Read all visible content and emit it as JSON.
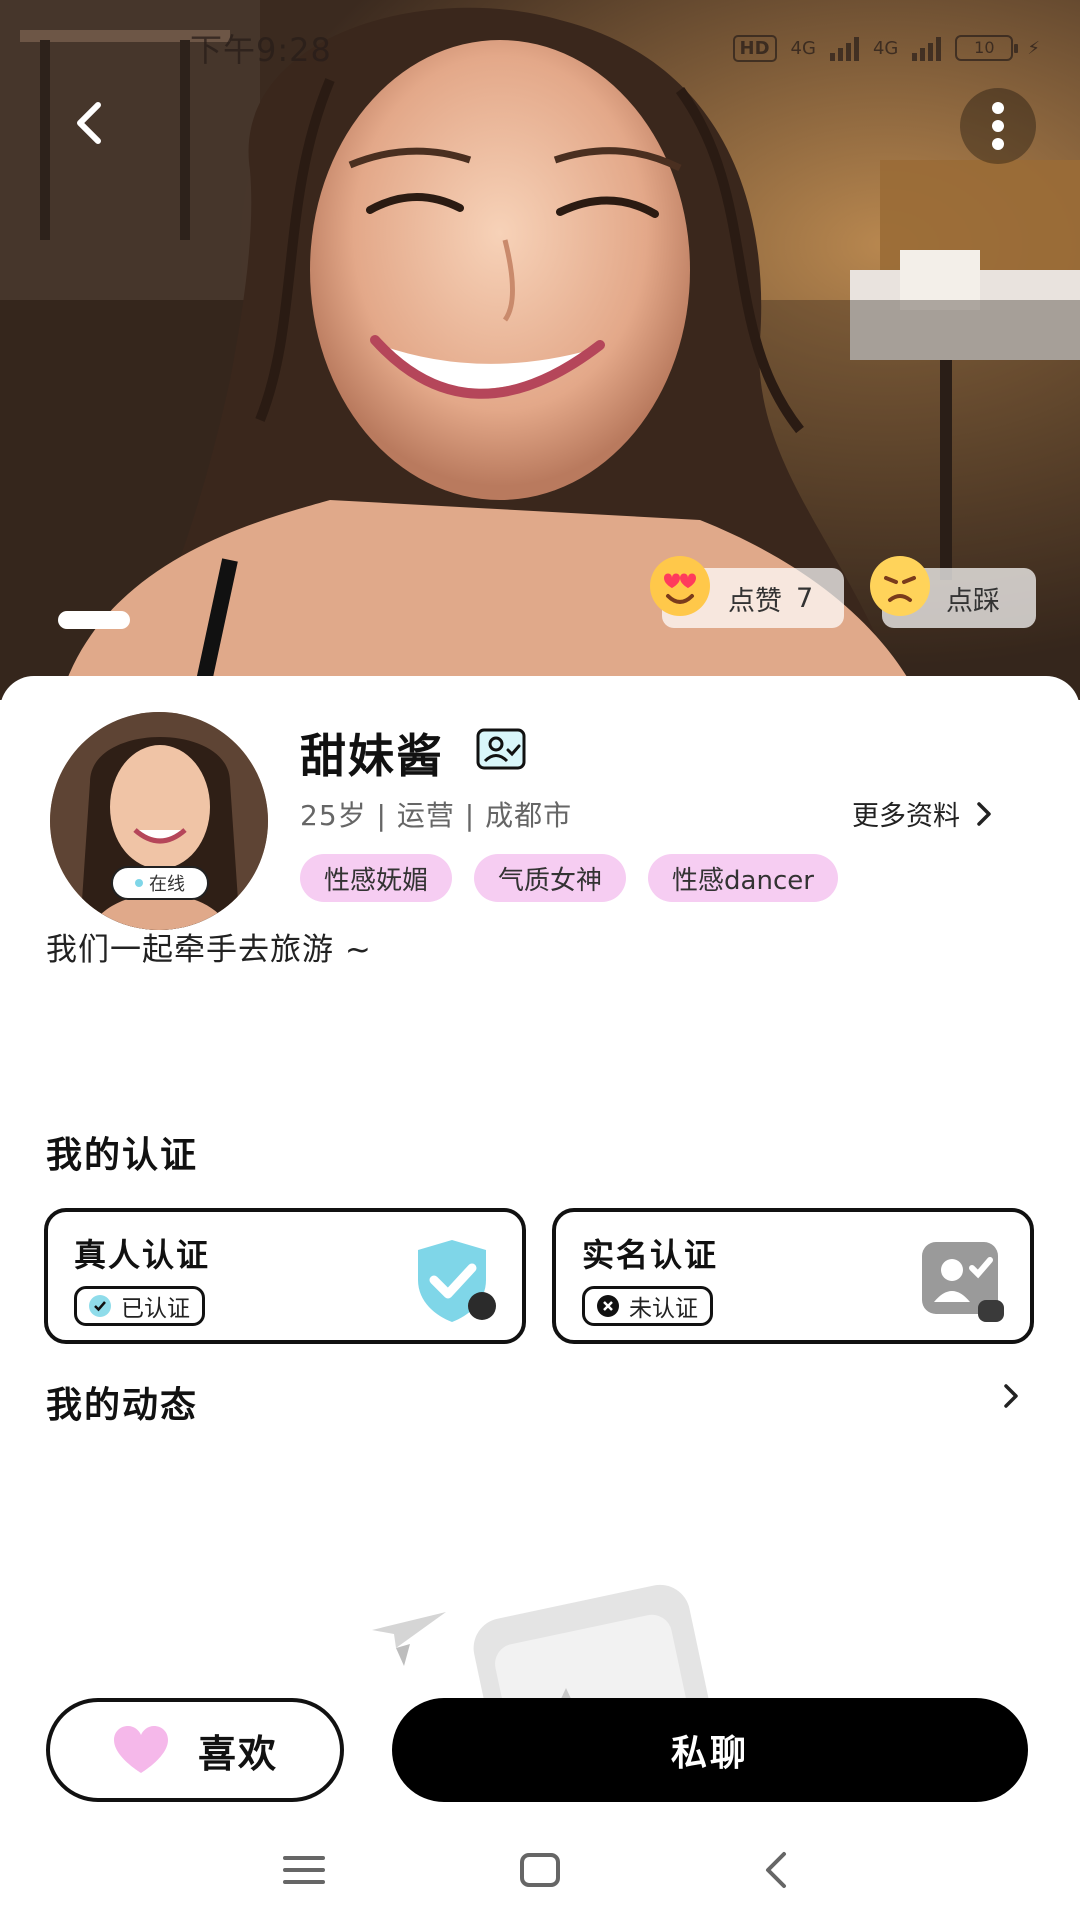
{
  "status_bar": {
    "time": "下午9:28",
    "hd": "HD",
    "network_1": "4G",
    "network_2": "4G",
    "battery": "10"
  },
  "hero": {
    "like": {
      "label": "点赞",
      "count": "7"
    },
    "dislike": {
      "label": "点踩"
    }
  },
  "profile": {
    "name": "甜妹酱",
    "online": "在线",
    "meta": "25岁 | 运营 | 成都市",
    "more_info": "更多资料",
    "tags": [
      "性感妩媚",
      "气质女神",
      "性感dancer"
    ],
    "bio": "我们一起牵手去旅游 ~"
  },
  "certification": {
    "title": "我的认证",
    "real_person": {
      "title": "真人认证",
      "status": "已认证"
    },
    "real_name": {
      "title": "实名认证",
      "status": "未认证"
    }
  },
  "moments": {
    "title": "我的动态"
  },
  "actions": {
    "like": "喜欢",
    "chat": "私聊"
  },
  "colors": {
    "accent_tag": "#f6cdf2",
    "accent_cyan": "#7fd6e8",
    "primary_button": "#000000"
  }
}
